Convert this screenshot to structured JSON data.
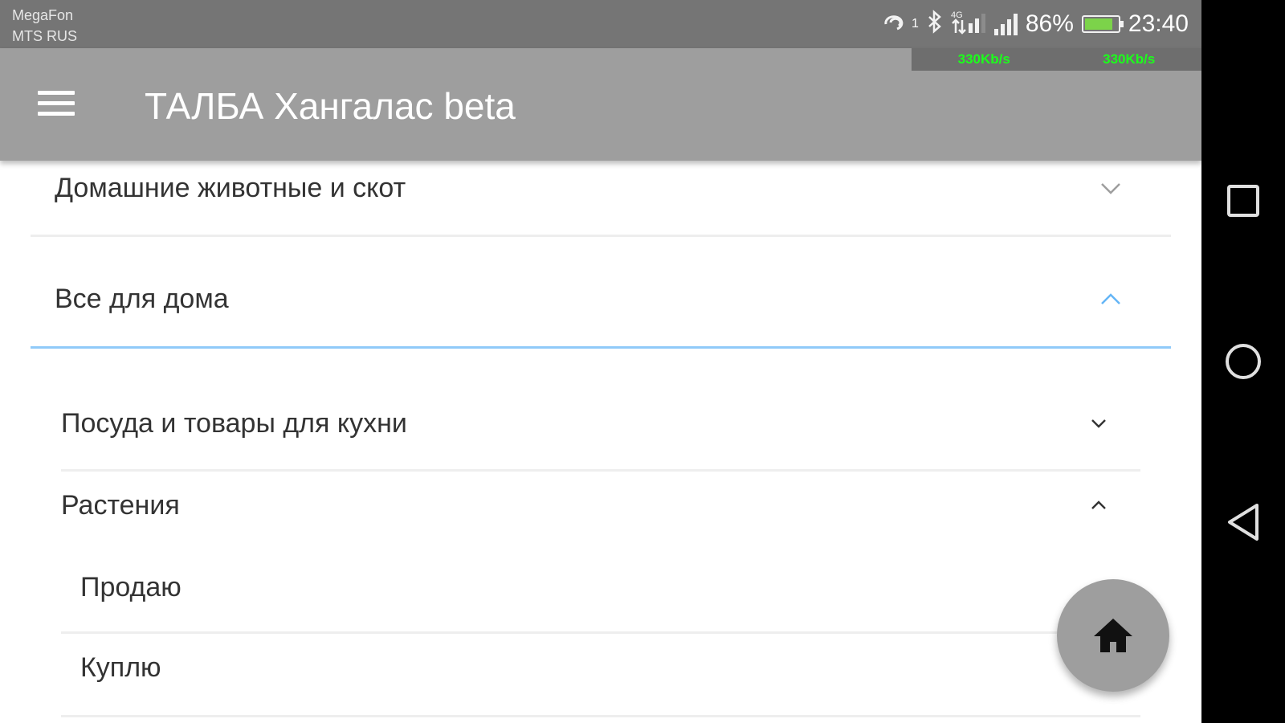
{
  "status_bar": {
    "carrier_1": "MegaFon",
    "carrier_2": "MTS RUS",
    "sim_indicator": "1",
    "battery_percent_text": "86%",
    "battery_level": 0.86,
    "battery_color": "#7cd34a",
    "time": "23:40",
    "speed_up": "330Kb/s",
    "speed_down": "330Kb/s",
    "icons": [
      "sync-icon",
      "bluetooth-icon",
      "lte-signal-icon",
      "signal-icon",
      "battery-charging-icon"
    ]
  },
  "app_bar": {
    "menu_icon": "hamburger-menu-icon",
    "title": "ТАЛБА Хангалас beta",
    "background": "#9e9e9e"
  },
  "categories": [
    {
      "label": "Домашние животные и скот",
      "state": "collapsed",
      "chevron_icon": "chevron-down-icon"
    },
    {
      "label": "Все для дома",
      "state": "expanded",
      "chevron_icon": "chevron-up-icon",
      "accent": "#90caf9"
    }
  ],
  "subcategories": [
    {
      "label": "Посуда и товары для кухни",
      "state": "collapsed",
      "chevron_icon": "chevron-down-icon"
    },
    {
      "label": "Растения",
      "state": "expanded",
      "chevron_icon": "chevron-up-icon"
    }
  ],
  "leaf_items": [
    {
      "label": "Продаю"
    },
    {
      "label": "Куплю"
    }
  ],
  "fab": {
    "icon": "home-icon"
  },
  "nav_bar": {
    "icons": [
      "recents-square-icon",
      "home-circle-icon",
      "back-triangle-icon"
    ]
  }
}
